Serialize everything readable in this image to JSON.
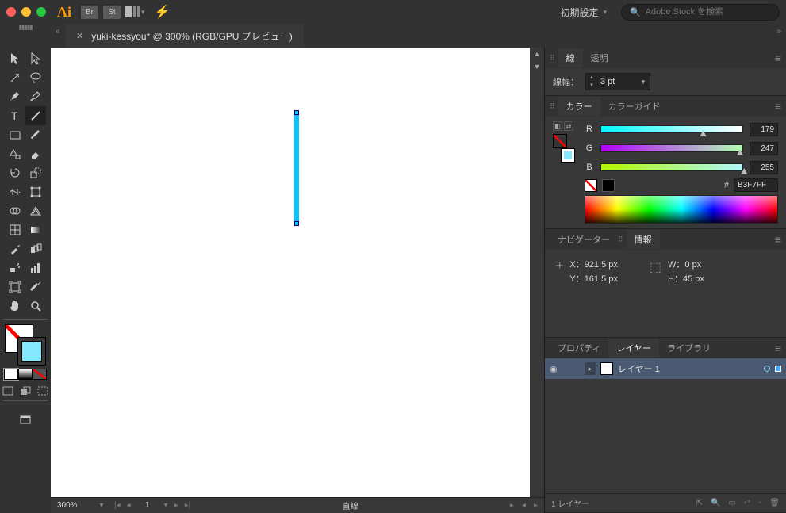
{
  "titlebar": {
    "workspace": "初期設定",
    "search_placeholder": "Adobe Stock を検索",
    "br_label": "Br",
    "st_label": "St"
  },
  "doc": {
    "title": "yuki-kessyou* @ 300% (RGB/GPU プレビュー)"
  },
  "stroke_panel": {
    "tab_stroke": "線",
    "tab_opacity": "透明",
    "weight_label": "線幅：",
    "weight_value": "3 pt"
  },
  "color_panel": {
    "tab_color": "カラー",
    "tab_guide": "カラーガイド",
    "R_label": "R",
    "G_label": "G",
    "B_label": "B",
    "R": "179",
    "G": "247",
    "B": "255",
    "hash": "#",
    "hex": "B3F7FF"
  },
  "nav_panel": {
    "tab_nav": "ナビゲーター",
    "tab_info": "情報"
  },
  "info": {
    "x_label": "X：",
    "x": "921.5 px",
    "y_label": "Y：",
    "y": "161.5 px",
    "w_label": "W：",
    "w": "0 px",
    "h_label": "H：",
    "h": "45 px"
  },
  "layers_panel": {
    "tab_properties": "プロパティ",
    "tab_layers": "レイヤー",
    "tab_library": "ライブラリ",
    "layer1": "レイヤー 1",
    "footer": "1 レイヤー"
  },
  "status": {
    "zoom": "300%",
    "page": "1",
    "tool": "直線"
  }
}
